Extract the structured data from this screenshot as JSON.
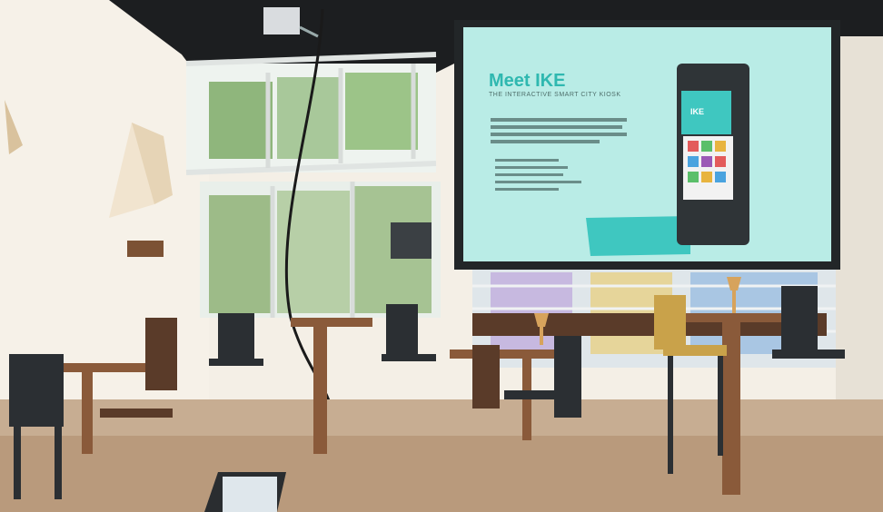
{
  "slide": {
    "title": "Meet IKE",
    "subtitle": "THE INTERACTIVE SMART CITY KIOSK",
    "kiosk_brand": "IKE",
    "colors": {
      "screen": "#b9ece6",
      "accent": "#3fc7c0",
      "title": "#2fb8b0",
      "kiosk": "#2f3437"
    }
  },
  "scene": {
    "colors": {
      "wall": "#f3efe7",
      "ceiling": "#1a1c1e",
      "floor": "#b99a7c",
      "window_light": "#eef3f1",
      "foliage": "#7fae6a",
      "wood": "#8a5a3a",
      "chair_dark": "#2b2f33",
      "chair_yellow": "#c9a24a"
    }
  }
}
